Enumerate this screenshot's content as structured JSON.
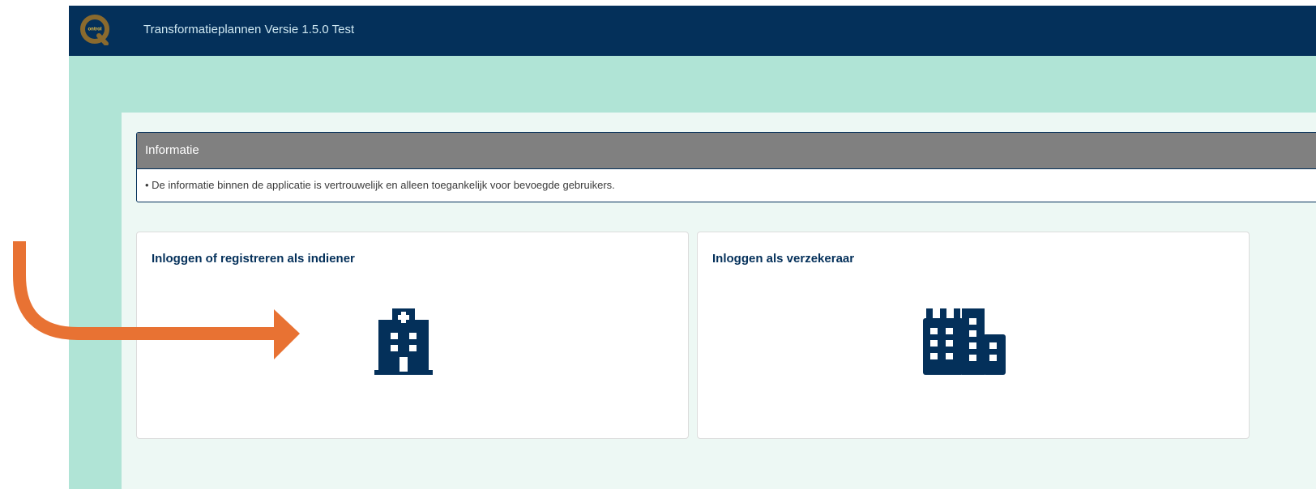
{
  "header": {
    "logo_alt": "Qontrol",
    "logo_text": "ontrol",
    "title": "Transformatieplannen Versie 1.5.0 Test"
  },
  "info": {
    "title": "Informatie",
    "text": "• De informatie binnen de applicatie is vertrouwelijk en alleen toegankelijk voor bevoegde gebruikers."
  },
  "cards": [
    {
      "title": "Inloggen of registreren als indiener",
      "icon": "hospital-icon"
    },
    {
      "title": "Inloggen als verzekeraar",
      "icon": "building-icon"
    }
  ],
  "colors": {
    "navy": "#04305a",
    "mint": "#b0e4d6",
    "arrow": "#e87233",
    "info_header": "#808080"
  }
}
